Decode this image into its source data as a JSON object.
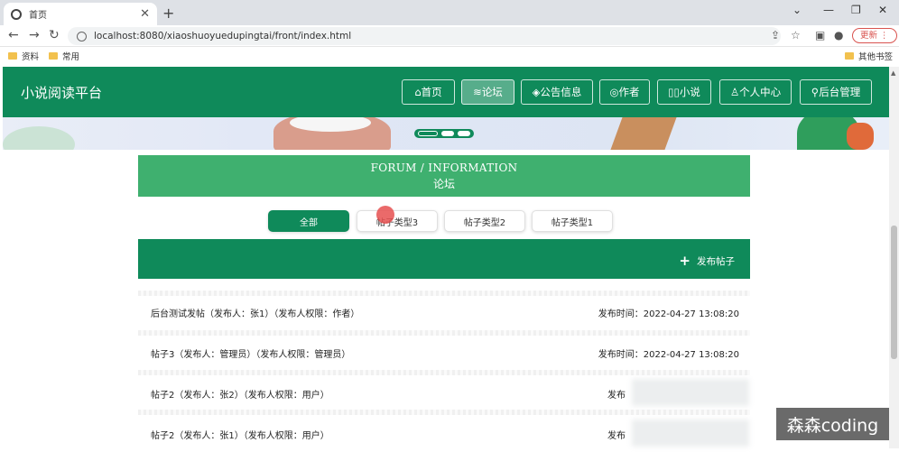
{
  "browser": {
    "tab_title": "首页",
    "tab_close": "✕",
    "new_tab": "+",
    "url": "localhost:8080/xiaoshuoyuedupingtai/front/index.html",
    "update_label": "更新",
    "bookmarks": [
      "资料",
      "常用"
    ],
    "other_bookmarks": "其他书签"
  },
  "site": {
    "brand": "小说阅读平台",
    "menu": [
      {
        "icon": "⌂",
        "label": "首页"
      },
      {
        "icon": "≋",
        "label": "论坛"
      },
      {
        "icon": "◈",
        "label": "公告信息"
      },
      {
        "icon": "◎",
        "label": "作者"
      },
      {
        "icon": "▯▯",
        "label": "小说"
      },
      {
        "icon": "♙",
        "label": "个人中心"
      },
      {
        "icon": "⚲",
        "label": "后台管理"
      }
    ],
    "active_menu": "论坛"
  },
  "forum": {
    "title_en": "FORUM / INFORMATION",
    "title_cn": "论坛",
    "categories": [
      "全部",
      "帖子类型3",
      "帖子类型2",
      "帖子类型1"
    ],
    "active_category": "全部",
    "post_button": "发布帖子",
    "posts": [
      {
        "title": "后台测试发帖（发布人：张1）（发布人权限：作者）",
        "time": "发布时间：2022-04-27 13:08:20"
      },
      {
        "title": "帖子3（发布人：管理员）（发布人权限：管理员）",
        "time": "发布时间：2022-04-27 13:08:20"
      },
      {
        "title": "帖子2（发布人：张2）（发布人权限：用户）",
        "time": "发布"
      },
      {
        "title": "帖子2（发布人：张1）（发布人权限：用户）",
        "time": "发布"
      }
    ]
  },
  "watermark": "森森coding",
  "colors": {
    "primary": "#0f8a5a",
    "title_bar": "#3fb06f"
  }
}
